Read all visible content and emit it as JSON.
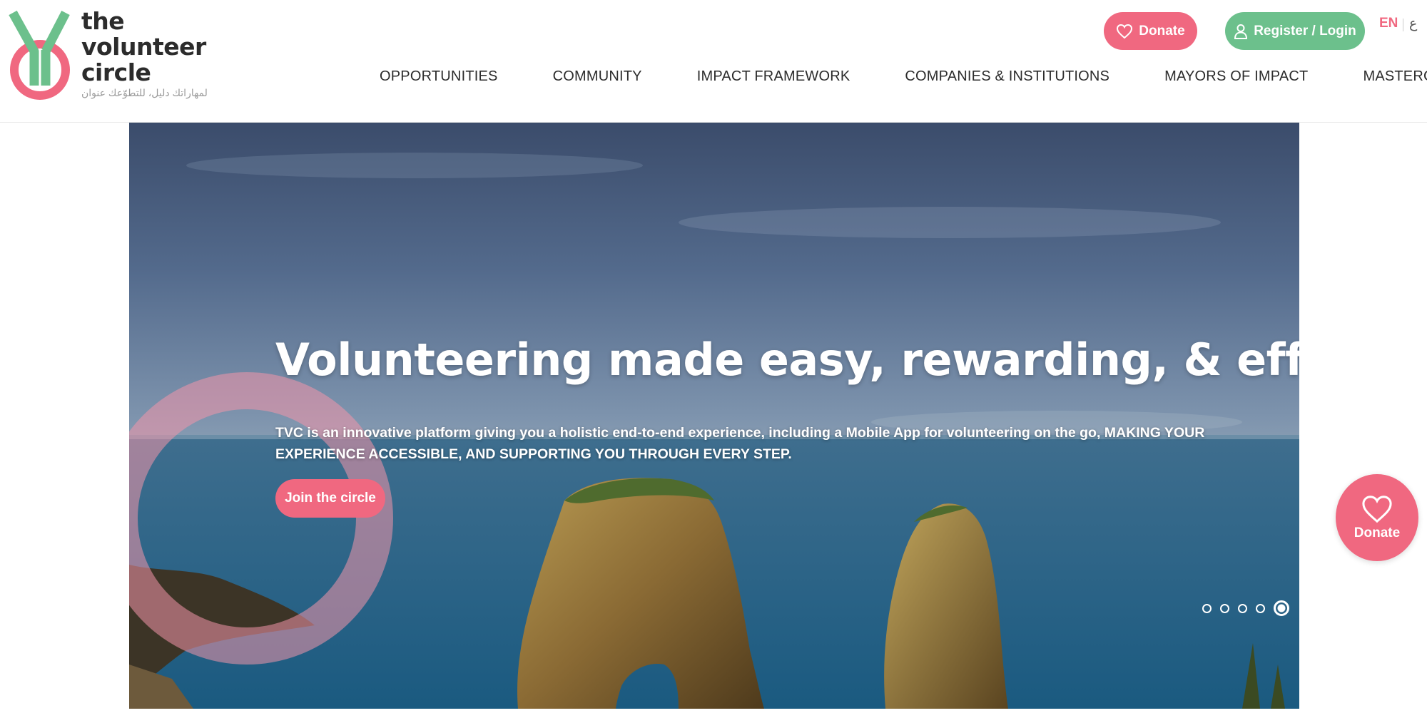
{
  "logo": {
    "line1": "the",
    "line2": "volunteer",
    "line3": "circle",
    "tagline": "لمهاراتك دليل، للتطوّعك عنوان"
  },
  "header": {
    "donate_label": "Donate",
    "register_label": "Register / Login",
    "lang_en": "EN",
    "lang_ar": "ع"
  },
  "nav": [
    {
      "label": "OPPORTUNITIES"
    },
    {
      "label": "COMMUNITY"
    },
    {
      "label": "IMPACT FRAMEWORK"
    },
    {
      "label": "COMPANIES & INSTITUTIONS"
    },
    {
      "label": "MAYORS OF IMPACT"
    },
    {
      "label": "MASTERCLASS"
    }
  ],
  "hero": {
    "title": "Volunteering made easy, rewarding, & efficient.",
    "description": "TVC is an innovative platform giving you a holistic end-to-end experience, including a Mobile App for volunteering on the go, MAKING YOUR EXPERIENCE ACCESSIBLE, AND SUPPORTING YOU THROUGH EVERY STEP.",
    "cta_label": "Join the circle",
    "slides_total": 5,
    "active_slide": 5
  },
  "floating_donate": {
    "label": "Donate"
  },
  "colors": {
    "brand_pink": "#f06880",
    "brand_green": "#6cc08c"
  }
}
